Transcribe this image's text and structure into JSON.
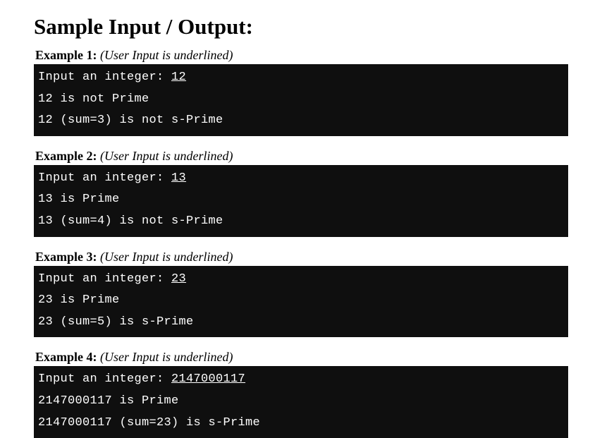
{
  "heading": "Sample Input / Output:",
  "note": "(User Input is underlined)",
  "examples": [
    {
      "label": "Example 1: ",
      "prompt": "Input an integer: ",
      "user_input": "12",
      "line2": "12 is not Prime",
      "line3": "12 (sum=3) is not s-Prime"
    },
    {
      "label": "Example 2: ",
      "prompt": "Input an integer: ",
      "user_input": "13",
      "line2": "13 is Prime",
      "line3": "13 (sum=4) is not s-Prime"
    },
    {
      "label": "Example 3: ",
      "prompt": "Input an integer: ",
      "user_input": "23",
      "line2": "23 is Prime",
      "line3": "23 (sum=5) is s-Prime"
    },
    {
      "label": "Example 4: ",
      "prompt": "Input an integer: ",
      "user_input": "2147000117",
      "line2": "2147000117 is Prime",
      "line3": "2147000117 (sum=23) is s-Prime"
    }
  ]
}
